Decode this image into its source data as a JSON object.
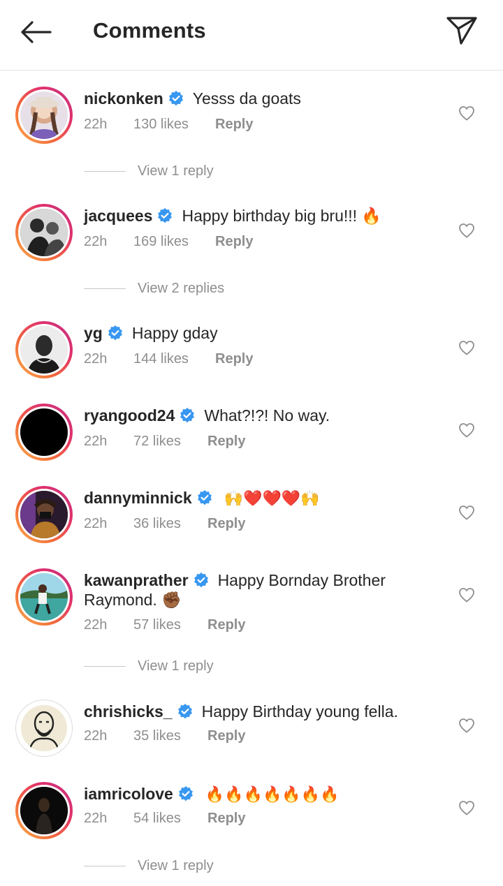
{
  "header": {
    "title": "Comments",
    "back_icon": "arrow-left-icon",
    "send_icon": "paper-plane-icon"
  },
  "colors": {
    "verified": "#3897f0",
    "muted": "#8e8e8e",
    "text": "#262626",
    "divider": "#e3e3e3"
  },
  "comments": [
    {
      "username": "nickonken",
      "verified": true,
      "text": "Yesss da goats",
      "time": "22h",
      "likes": "130 likes",
      "reply_label": "Reply",
      "view_replies": "View 1 reply"
    },
    {
      "username": "jacquees",
      "verified": true,
      "text": "Happy birthday big bru!!! 🔥",
      "time": "22h",
      "likes": "169 likes",
      "reply_label": "Reply",
      "view_replies": "View 2 replies"
    },
    {
      "username": "yg",
      "verified": true,
      "text": "Happy gday",
      "time": "22h",
      "likes": "144 likes",
      "reply_label": "Reply"
    },
    {
      "username": "ryangood24",
      "verified": true,
      "text": "What?!?! No way.",
      "time": "22h",
      "likes": "72 likes",
      "reply_label": "Reply"
    },
    {
      "username": "dannyminnick",
      "verified": true,
      "text": "🙌❤️❤️❤️🙌",
      "time": "22h",
      "likes": "36 likes",
      "reply_label": "Reply"
    },
    {
      "username": "kawanprather",
      "verified": true,
      "text": "Happy Bornday Brother Raymond. ✊🏾",
      "time": "22h",
      "likes": "57 likes",
      "reply_label": "Reply",
      "view_replies": "View 1 reply"
    },
    {
      "username": "chrishicks_",
      "verified": true,
      "text": "Happy Birthday young fella.",
      "time": "22h",
      "likes": "35 likes",
      "reply_label": "Reply"
    },
    {
      "username": "iamricolove",
      "verified": true,
      "text": "🔥🔥🔥🔥🔥🔥🔥",
      "time": "22h",
      "likes": "54 likes",
      "reply_label": "Reply",
      "view_replies": "View 1 reply"
    }
  ]
}
